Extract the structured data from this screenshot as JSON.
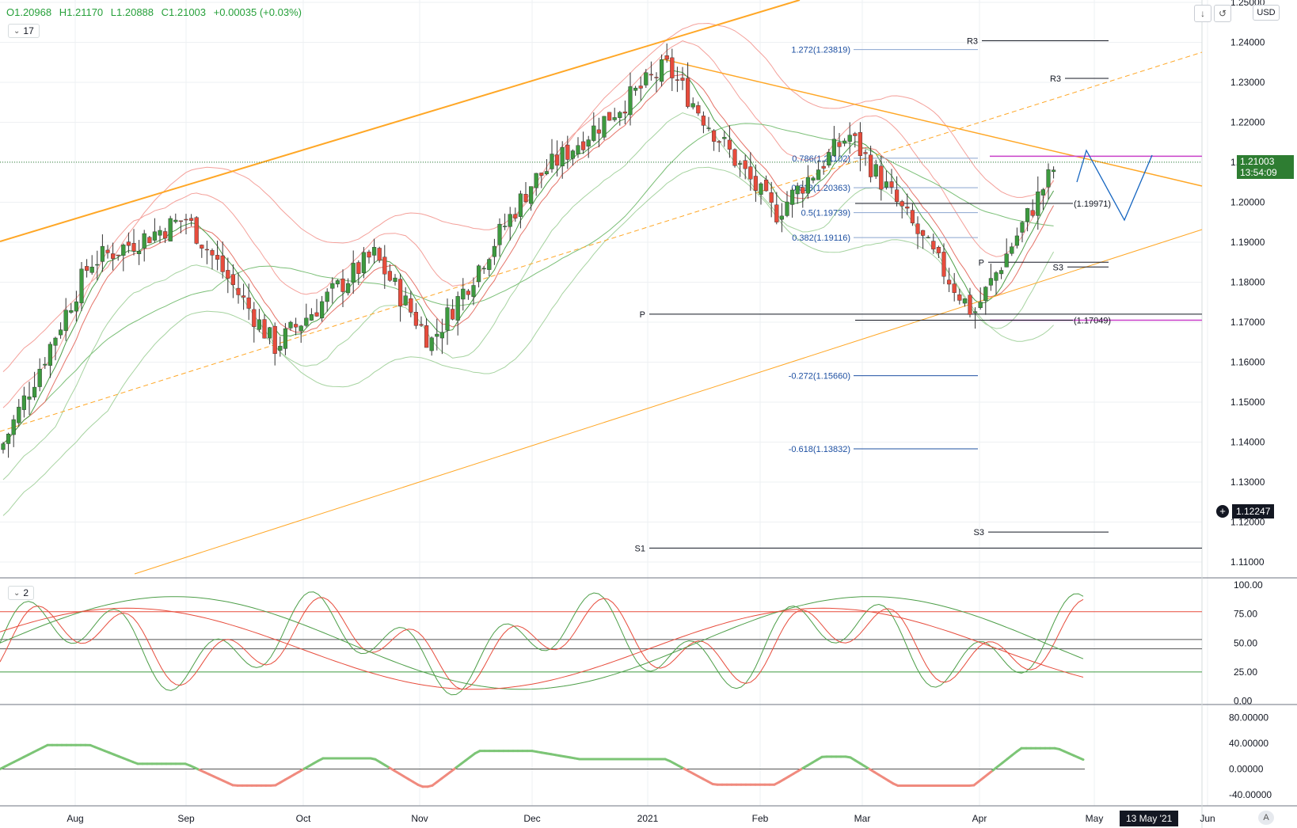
{
  "header": {
    "open": "O1.20968",
    "high": "H1.21170",
    "low": "L1.20888",
    "close": "C1.21003",
    "change": "+0.00035 (+0.03%)",
    "indicator_count": "17",
    "currency": "USD"
  },
  "indicators": {
    "stoch_label": "2"
  },
  "price_labels": {
    "last_price": "1.21003",
    "countdown": "13:54:09",
    "crosshair_price": "1.12247",
    "crosshair_date": "13 May '21",
    "auto_label": "A"
  },
  "colors": {
    "bull": "#3d9a3f",
    "bear": "#e74c3c",
    "trend": "#ffa726",
    "fib": "#1e50a2",
    "magenta": "#c940c9",
    "forecast": "#1565c0"
  },
  "chart_data": [
    {
      "type": "candlestick",
      "axis": {
        "ylim": [
          1.1,
          1.25
        ],
        "y_ticks": [
          "1.25000",
          "1.24000",
          "1.23000",
          "1.22000",
          "1.21000",
          "1.20000",
          "1.19000",
          "1.18000",
          "1.17000",
          "1.16000",
          "1.15000",
          "1.14000",
          "1.13000",
          "1.12000",
          "1.11000"
        ],
        "x_labels": [
          "Aug",
          "Sep",
          "Oct",
          "Nov",
          "Dec",
          "2021",
          "Feb",
          "Mar",
          "Apr",
          "May",
          "Jun"
        ]
      },
      "key_points": [
        {
          "date": "Jul 20",
          "close": 1.138
        },
        {
          "date": "Aug 5",
          "close": 1.185
        },
        {
          "date": "Sep 1",
          "close": 1.196
        },
        {
          "date": "Sep 25",
          "close": 1.164
        },
        {
          "date": "Oct 20",
          "close": 1.187
        },
        {
          "date": "Nov 4",
          "close": 1.165
        },
        {
          "date": "Dec 1",
          "close": 1.205
        },
        {
          "date": "Jan 6",
          "close": 1.234
        },
        {
          "date": "Feb 5",
          "close": 1.197
        },
        {
          "date": "Feb 25",
          "close": 1.217
        },
        {
          "date": "Mar 31",
          "close": 1.172
        },
        {
          "date": "Apr 22",
          "close": 1.21
        }
      ],
      "fib_levels": [
        {
          "label": "1.272(1.23819)",
          "value": 1.23819
        },
        {
          "label": "0.786(1.21102)",
          "value": 1.21102
        },
        {
          "label": "0.618(1.20363)",
          "value": 1.20363
        },
        {
          "label": "0.5(1.19739)",
          "value": 1.19739
        },
        {
          "label": "0.382(1.19116)",
          "value": 1.19116
        },
        {
          "label": "-0.272(1.15660)",
          "value": 1.1566
        },
        {
          "label": "-0.618(1.13832)",
          "value": 1.13832
        }
      ],
      "pivot_levels": [
        {
          "label": "R3",
          "value": 1.2404
        },
        {
          "label": "R3",
          "value": 1.231
        },
        {
          "label": "P",
          "value": 1.172
        },
        {
          "label": "S1",
          "value": 1.1135
        },
        {
          "label": "P",
          "value": 1.185
        },
        {
          "label": "S3",
          "value": 1.1838
        },
        {
          "label": "S3",
          "value": 1.1175
        }
      ],
      "level_labels": [
        {
          "label": "(1.19971)",
          "value": 1.19971
        },
        {
          "label": "(1.17049)",
          "value": 1.17049
        }
      ]
    },
    {
      "type": "line",
      "name": "stochastic",
      "ylim": [
        0,
        100
      ],
      "y_ticks": [
        "100.00",
        "75.00",
        "50.00",
        "25.00",
        "0.00"
      ],
      "levels": [
        77,
        53,
        45,
        25
      ]
    },
    {
      "type": "line",
      "name": "oscillator",
      "ylim": [
        -50,
        90
      ],
      "y_ticks": [
        "80.00000",
        "40.00000",
        "0.00000",
        "-40.00000"
      ],
      "baseline": 0
    }
  ]
}
